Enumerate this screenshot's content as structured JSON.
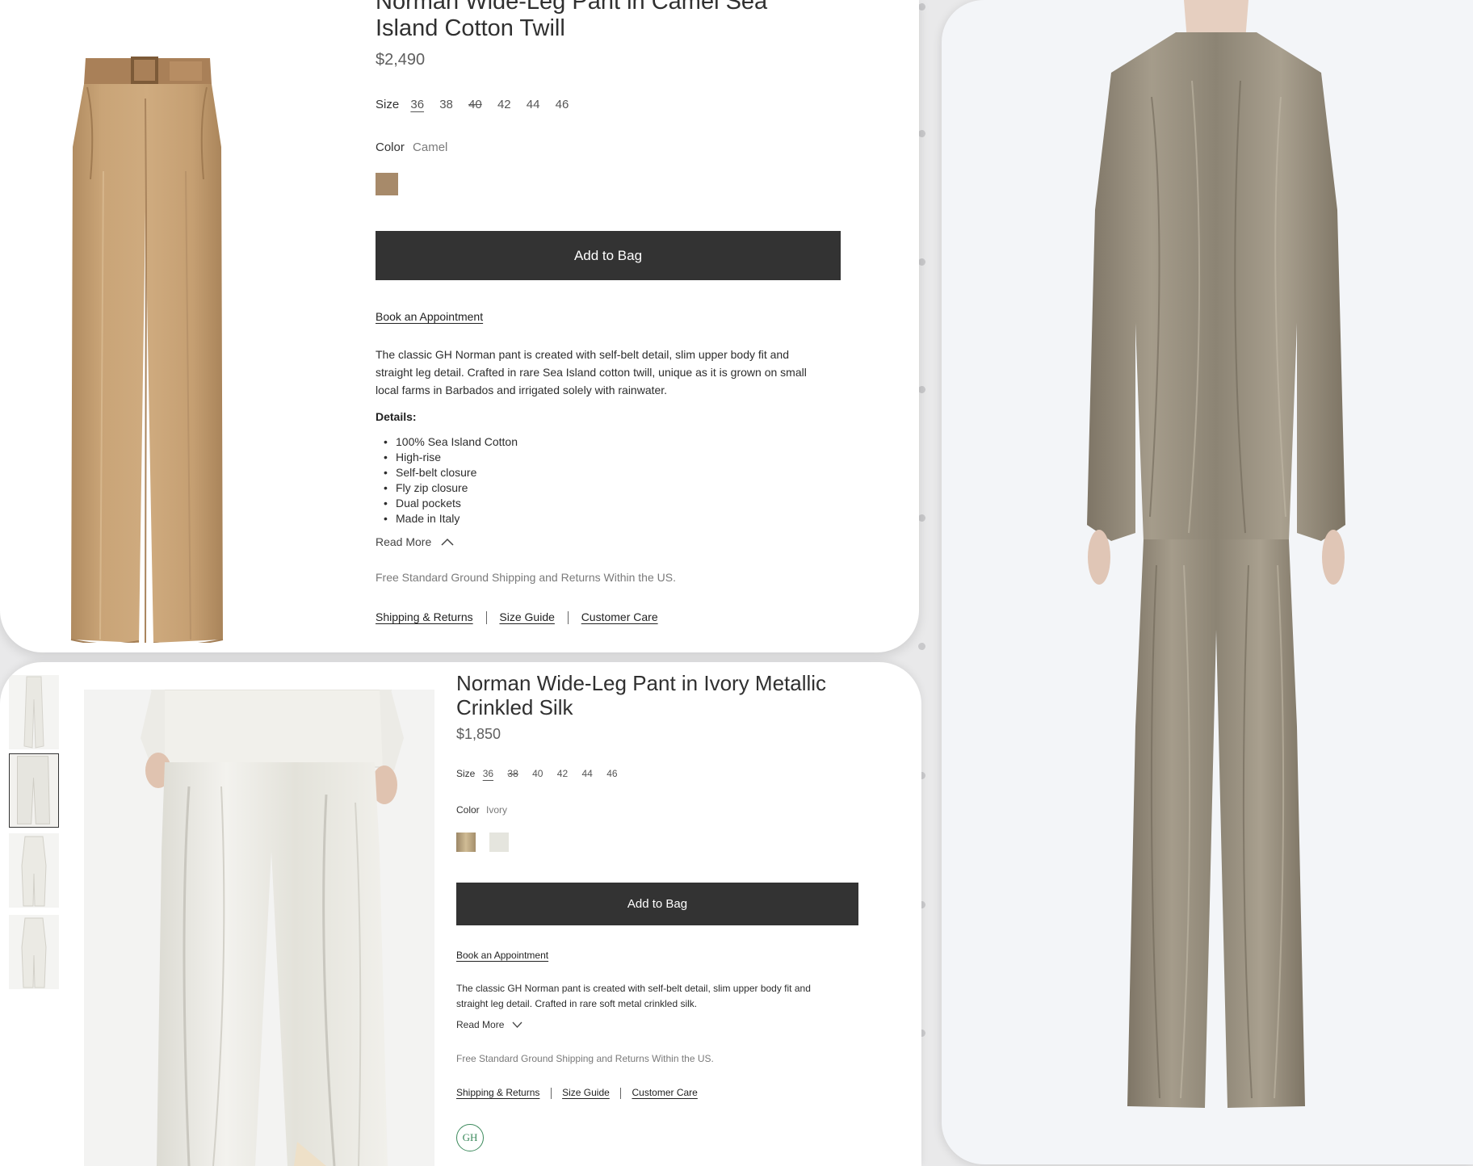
{
  "top_product": {
    "title_line1": "Norman Wide-Leg Pant in Camel Sea",
    "title_line2": "Island Cotton Twill",
    "price": "$2,490",
    "size_label": "Size",
    "sizes": [
      "36",
      "38",
      "40",
      "42",
      "44",
      "46"
    ],
    "color_label": "Color",
    "color_value": "Camel",
    "swatch_color": "#a78a6a",
    "add_to_bag": "Add to Bag",
    "book_appointment": "Book an Appointment",
    "description_lines": [
      "The classic GH Norman pant is created with self-belt detail, slim upper body fit and",
      "straight leg detail. Crafted in rare Sea Island cotton twill, unique as it is grown on small",
      "local farms in Barbados and irrigated solely with rainwater."
    ],
    "details_heading": "Details:",
    "details": [
      "100% Sea Island Cotton",
      "High-rise",
      "Self-belt closure",
      "Fly zip closure",
      "Dual pockets",
      "Made in Italy"
    ],
    "read_more": "Read More",
    "shipping_note": "Free Standard Ground Shipping and Returns Within the US.",
    "links": [
      "Shipping & Returns",
      "Size Guide",
      "Customer Care"
    ]
  },
  "bottom_product": {
    "title_line1": "Norman Wide-Leg Pant in Ivory Metallic",
    "title_line2": "Crinkled Silk",
    "price": "$1,850",
    "size_label": "Size",
    "sizes": [
      "36",
      "38",
      "40",
      "42",
      "44",
      "46"
    ],
    "color_label": "Color",
    "color_value": "Ivory",
    "swatches": [
      {
        "name": "metallic",
        "color": "#b9a27f"
      },
      {
        "name": "ivory",
        "color": "#e5e5de"
      }
    ],
    "add_to_bag": "Add to Bag",
    "book_appointment": "Book an Appointment",
    "description_lines": [
      "The classic GH Norman pant is created with self-belt detail, slim upper body fit and",
      "straight leg detail. Crafted in rare soft metal crinkled silk."
    ],
    "read_more": "Read More",
    "shipping_note": "Free Standard Ground Shipping and Returns Within the US.",
    "links": [
      "Shipping & Returns",
      "Size Guide",
      "Customer Care"
    ],
    "badge_text": "GH"
  },
  "colors": {
    "button_bg": "#333333",
    "camel": "#c9a477",
    "ivory": "#f1f0ec",
    "metallic": "#8a8272"
  }
}
